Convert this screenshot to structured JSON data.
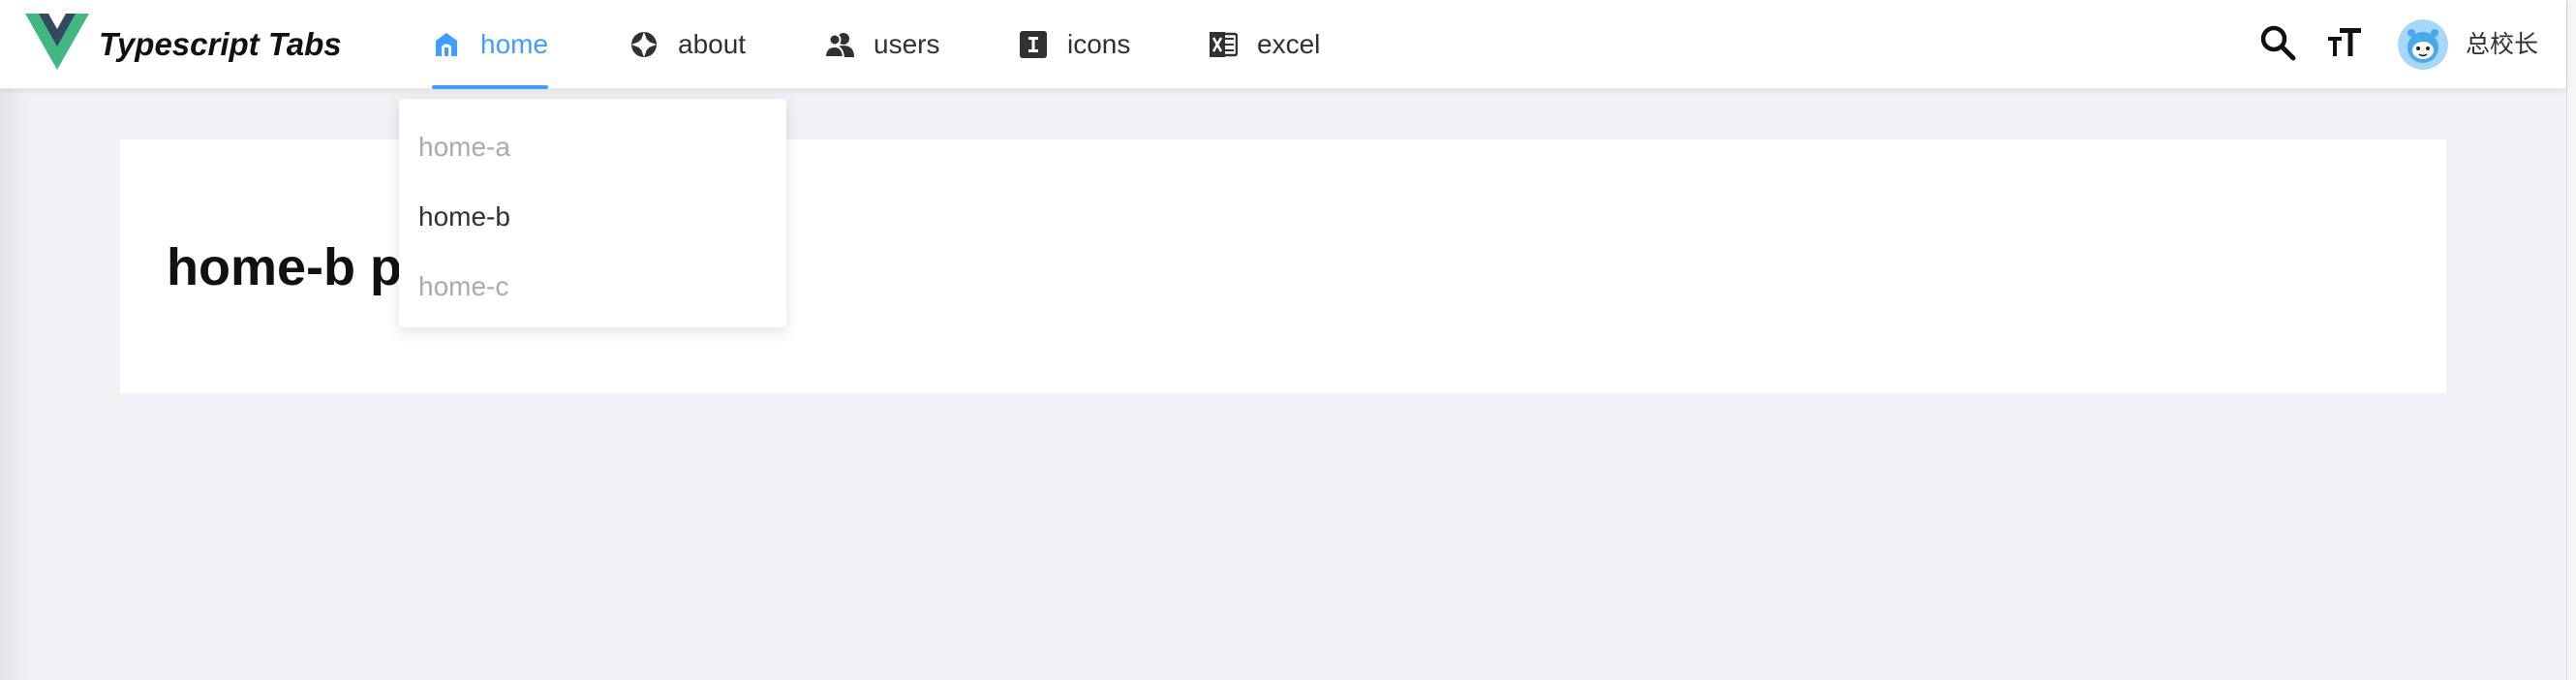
{
  "brand": {
    "title": "Typescript Tabs"
  },
  "nav": {
    "items": [
      {
        "label": "home",
        "icon": "home-icon",
        "active": true
      },
      {
        "label": "about",
        "icon": "aperture-icon",
        "active": false
      },
      {
        "label": "users",
        "icon": "users-icon",
        "active": false
      },
      {
        "label": "icons",
        "icon": "text-cursor-icon",
        "active": false
      },
      {
        "label": "excel",
        "icon": "excel-icon",
        "active": false
      }
    ]
  },
  "dropdown": {
    "items": [
      {
        "label": "home-a",
        "current": false
      },
      {
        "label": "home-b",
        "current": true
      },
      {
        "label": "home-c",
        "current": false
      }
    ]
  },
  "header_right": {
    "search_icon": "search-icon",
    "font_size_icon": "font-size-icon",
    "user": {
      "name": "总校长"
    }
  },
  "main": {
    "title": "home-b page"
  },
  "colors": {
    "accent": "#409eff",
    "background": "#f0f2f6",
    "logo_green": "#41b883",
    "logo_dark": "#35495e"
  }
}
